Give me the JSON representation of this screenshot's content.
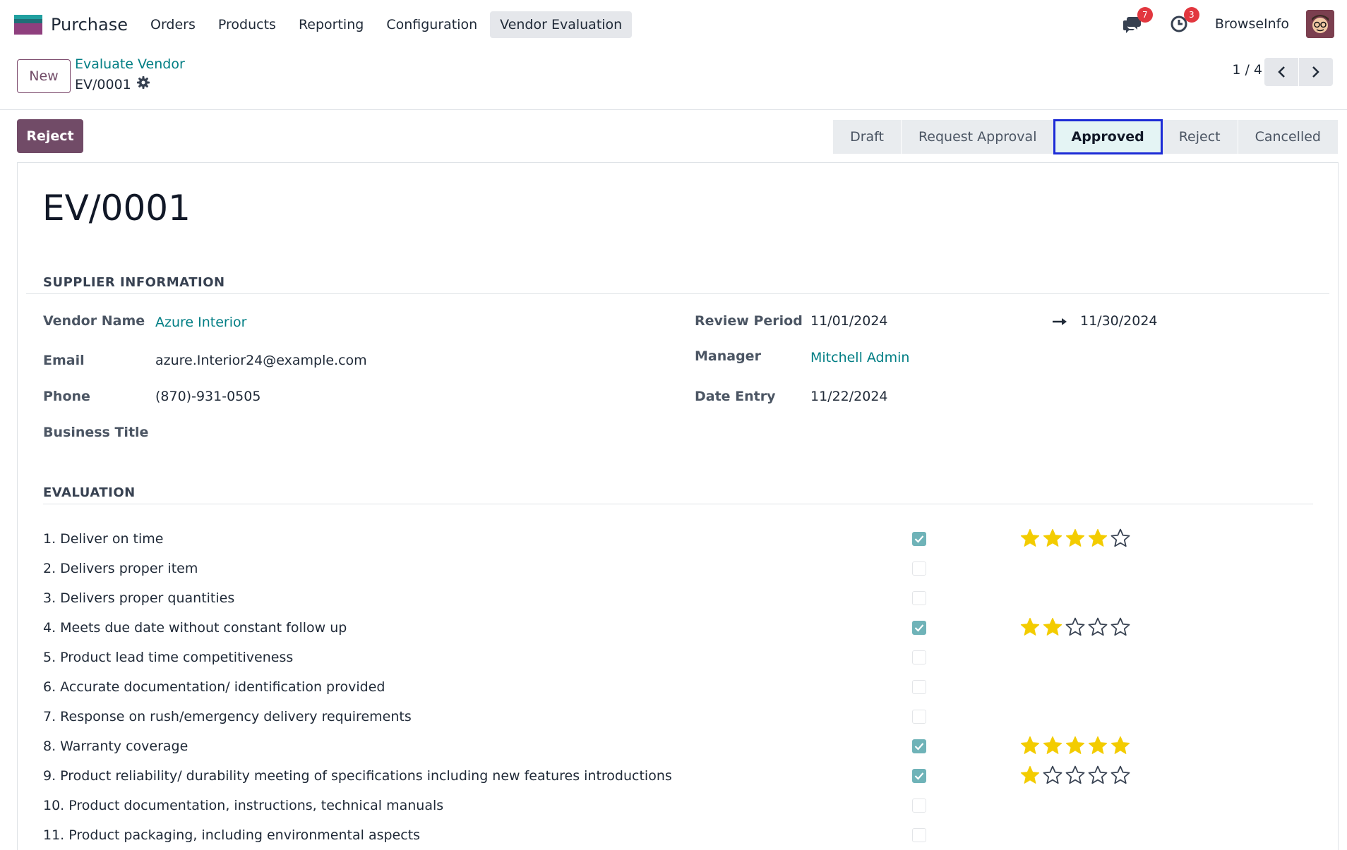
{
  "navbar": {
    "app_name": "Purchase",
    "menu": [
      "Orders",
      "Products",
      "Reporting",
      "Configuration",
      "Vendor Evaluation"
    ],
    "active_menu": "Vendor Evaluation",
    "messages_count": "7",
    "activities_count": "3",
    "company": "BrowseInfo"
  },
  "control": {
    "new_label": "New",
    "breadcrumb_parent": "Evaluate Vendor",
    "breadcrumb_current": "EV/0001",
    "pager": "1 / 4"
  },
  "statusbar": {
    "reject_button": "Reject",
    "stages": [
      "Draft",
      "Request Approval",
      "Approved",
      "Reject",
      "Cancelled"
    ],
    "current_stage": "Approved"
  },
  "record": {
    "title": "EV/0001",
    "supplier_section": "SUPPLIER INFORMATION",
    "vendor_name_label": "Vendor Name",
    "vendor_name": "Azure Interior",
    "email_label": "Email",
    "email": "azure.Interior24@example.com",
    "phone_label": "Phone",
    "phone": "(870)-931-0505",
    "business_title_label": "Business Title",
    "review_period_label": "Review Period",
    "review_start": "11/01/2024",
    "review_end": "11/30/2024",
    "manager_label": "Manager",
    "manager": "Mitchell Admin",
    "date_entry_label": "Date Entry",
    "date_entry": "11/22/2024",
    "evaluation_section": "EVALUATION"
  },
  "evaluation": [
    {
      "label": "1. Deliver on time",
      "checked": true,
      "rating": 4
    },
    {
      "label": "2. Delivers proper item",
      "checked": false,
      "rating": 0
    },
    {
      "label": "3. Delivers proper quantities",
      "checked": false,
      "rating": 0
    },
    {
      "label": "4. Meets due date without constant follow up",
      "checked": true,
      "rating": 2
    },
    {
      "label": "5. Product lead time competitiveness",
      "checked": false,
      "rating": 0
    },
    {
      "label": "6. Accurate documentation/ identification provided",
      "checked": false,
      "rating": 0
    },
    {
      "label": "7. Response on rush/emergency delivery requirements",
      "checked": false,
      "rating": 0
    },
    {
      "label": "8. Warranty coverage",
      "checked": true,
      "rating": 5
    },
    {
      "label": "9. Product reliability/ durability meeting of specifications including new features introductions",
      "checked": true,
      "rating": 1
    },
    {
      "label": "10. Product documentation, instructions, technical manuals",
      "checked": false,
      "rating": 0
    },
    {
      "label": "11. Product packaging, including environmental aspects",
      "checked": false,
      "rating": 0
    }
  ],
  "colors": {
    "brand": "#714b67",
    "link": "#017e84",
    "star_filled": "#f3cc00",
    "checkbox_checked": "#6fb3b8",
    "current_stage_outline": "#1c2bd6"
  }
}
